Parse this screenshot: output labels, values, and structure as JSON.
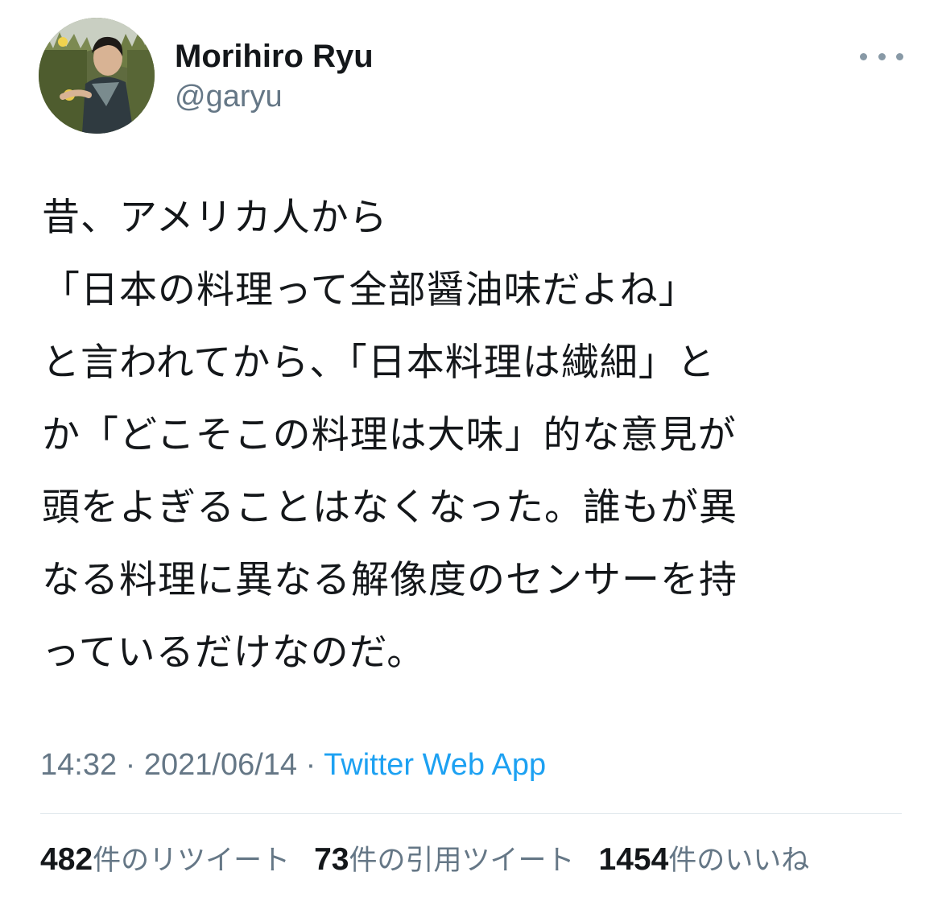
{
  "author": {
    "display_name": "Morihiro Ryu",
    "handle": "@garyu",
    "avatar_icon": "profile-photo"
  },
  "more_icon": "more-options-icon",
  "tweet": {
    "lines": [
      "昔、アメリカ人から",
      "「日本の料理って全部醤油味だよね」",
      "と言われてから、「日本料理は繊細」と",
      "か「どこそこの料理は大味」的な意見が",
      "頭をよぎることはなくなった。誰もが異",
      "なる料理に異なる解像度のセンサーを持",
      "っているだけなのだ。"
    ]
  },
  "meta": {
    "time": "14:32",
    "separator": " · ",
    "date": "2021/06/14",
    "source": "Twitter Web App"
  },
  "stats": {
    "retweets": {
      "count": "482",
      "label": "件のリツイート"
    },
    "quotes": {
      "count": "73",
      "label": "件の引用ツイート"
    },
    "likes": {
      "count": "1454",
      "label": "件のいいね"
    }
  },
  "colors": {
    "text": "#14171a",
    "muted": "#657786",
    "link": "#1da1f2",
    "divider": "#e1e8ed"
  }
}
